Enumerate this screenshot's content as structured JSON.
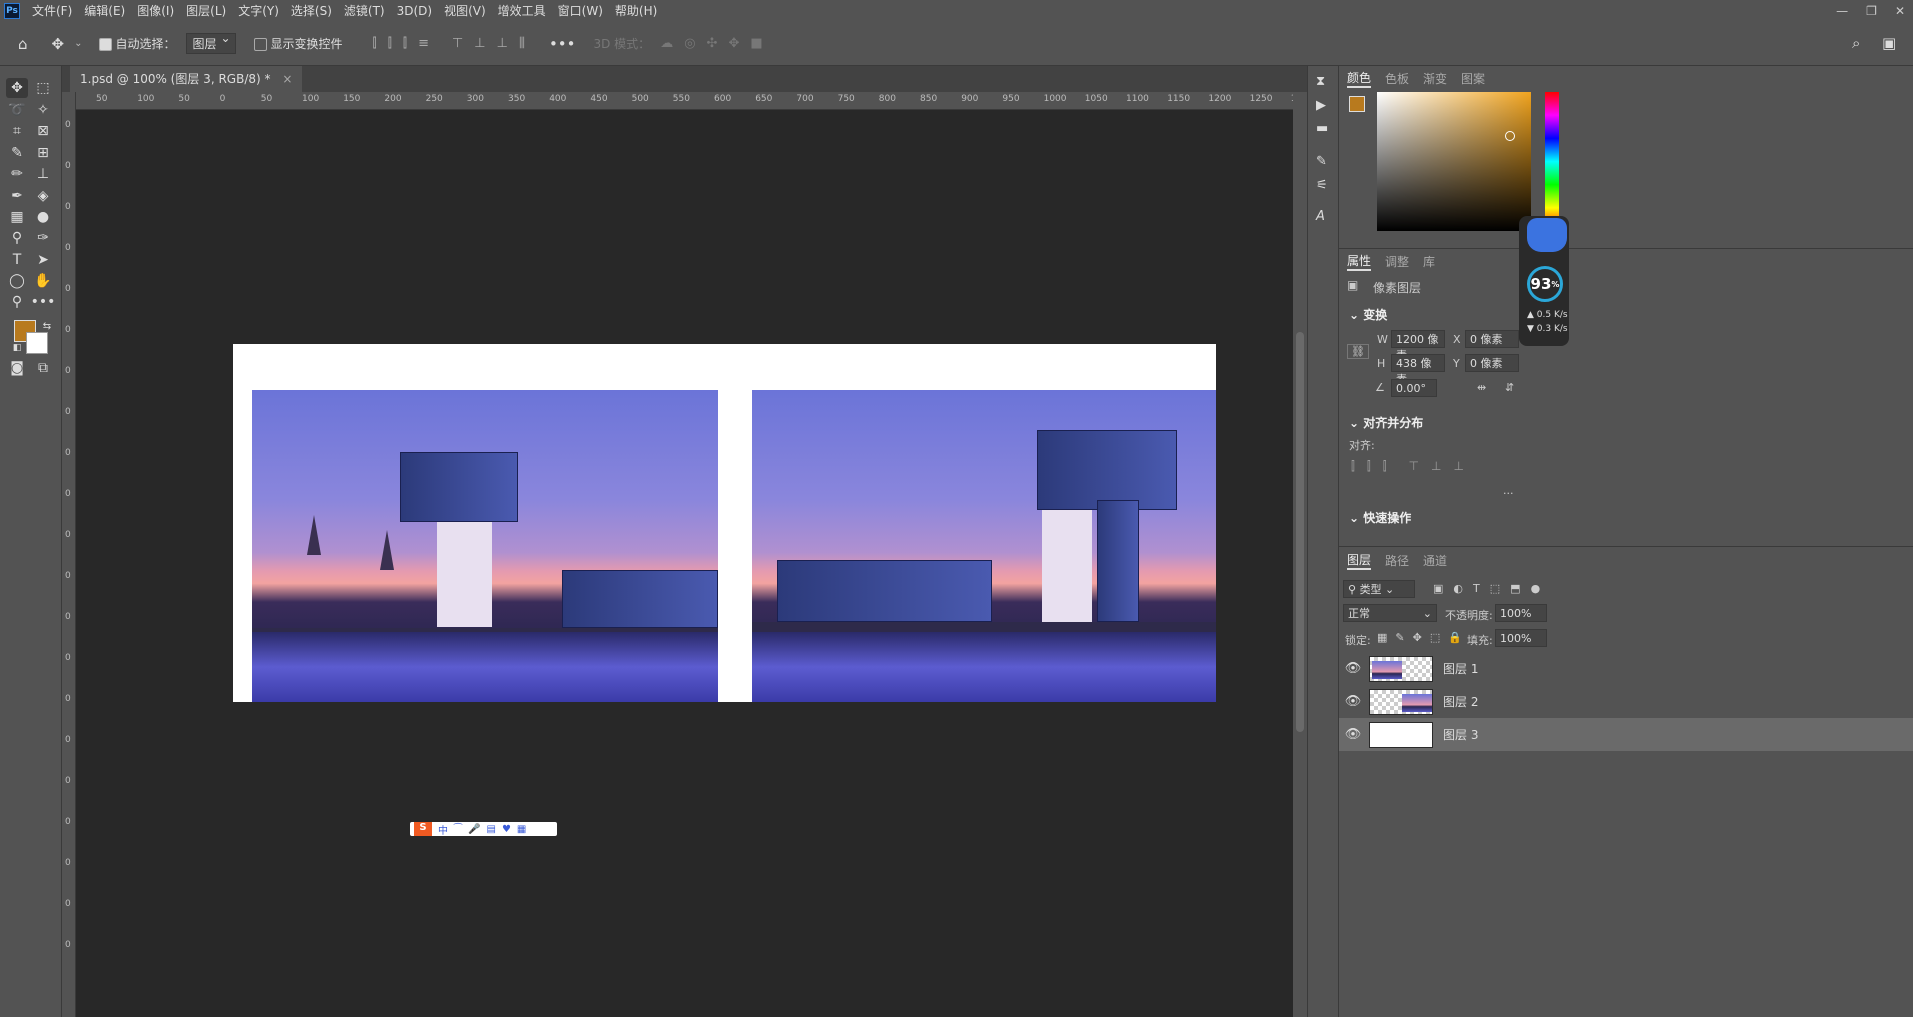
{
  "app": {
    "logo": "Ps"
  },
  "menu": [
    "文件(F)",
    "编辑(E)",
    "图像(I)",
    "图层(L)",
    "文字(Y)",
    "选择(S)",
    "滤镜(T)",
    "3D(D)",
    "视图(V)",
    "增效工具",
    "窗口(W)",
    "帮助(H)"
  ],
  "window_controls": [
    "minimize-icon",
    "restore-icon",
    "close-icon"
  ],
  "options": {
    "auto_select_label": "自动选择：",
    "auto_select_checked": true,
    "auto_select_target": "图层",
    "show_transform_label": "显示变换控件",
    "show_transform_checked": false,
    "mode_3d_label": "3D 模式："
  },
  "document": {
    "tab_title": "1.psd @ 100% (图层 3, RGB/8) *"
  },
  "ruler_h": [
    "50",
    "100",
    "50",
    "0",
    "50",
    "100",
    "150",
    "200",
    "250",
    "300",
    "350",
    "400",
    "450",
    "500",
    "550",
    "600",
    "650",
    "700",
    "750",
    "800",
    "850",
    "900",
    "950",
    "1000",
    "1050",
    "1100",
    "1150",
    "1200",
    "1250",
    "1300"
  ],
  "ruler_v": [
    "0",
    "0",
    "0",
    "0",
    "0",
    "0",
    "0",
    "0",
    "0",
    "0",
    "0",
    "0",
    "0",
    "0",
    "0",
    "0",
    "0",
    "0",
    "0",
    "0",
    "0"
  ],
  "colors": {
    "foreground": "#b87a1e",
    "background": "#ffffff"
  },
  "color_panel": {
    "tabs": [
      "颜色",
      "色板",
      "渐变",
      "图案"
    ],
    "active": 0
  },
  "properties_panel": {
    "tabs": [
      "属性",
      "调整",
      "库"
    ],
    "type_label": "像素图层",
    "transform_title": "变换",
    "w_label": "W",
    "w_value": "1200 像素",
    "h_label": "H",
    "h_value": "438 像素",
    "x_label": "X",
    "x_value": "0 像素",
    "y_label": "Y",
    "y_value": "0 像素",
    "angle_value": "0.00°",
    "align_title": "对齐并分布",
    "align_label": "对齐:",
    "quick_title": "快速操作",
    "more": "..."
  },
  "layers_panel": {
    "tabs": [
      "图层",
      "路径",
      "通道"
    ],
    "filter_label": "类型",
    "blend_mode": "正常",
    "opacity_label": "不透明度:",
    "opacity_value": "100%",
    "lock_label": "锁定:",
    "fill_label": "填充:",
    "fill_value": "100%",
    "layers": [
      {
        "name": "图层 1",
        "visible": true,
        "selected": false
      },
      {
        "name": "图层 2",
        "visible": true,
        "selected": false
      },
      {
        "name": "图层 3",
        "visible": true,
        "selected": true
      }
    ]
  },
  "meter": {
    "value": "93",
    "unit": "%",
    "up": "0.5",
    "down": "0.3",
    "rate_unit": "K/s"
  },
  "ime": {
    "logo": "S",
    "mode": "中"
  }
}
